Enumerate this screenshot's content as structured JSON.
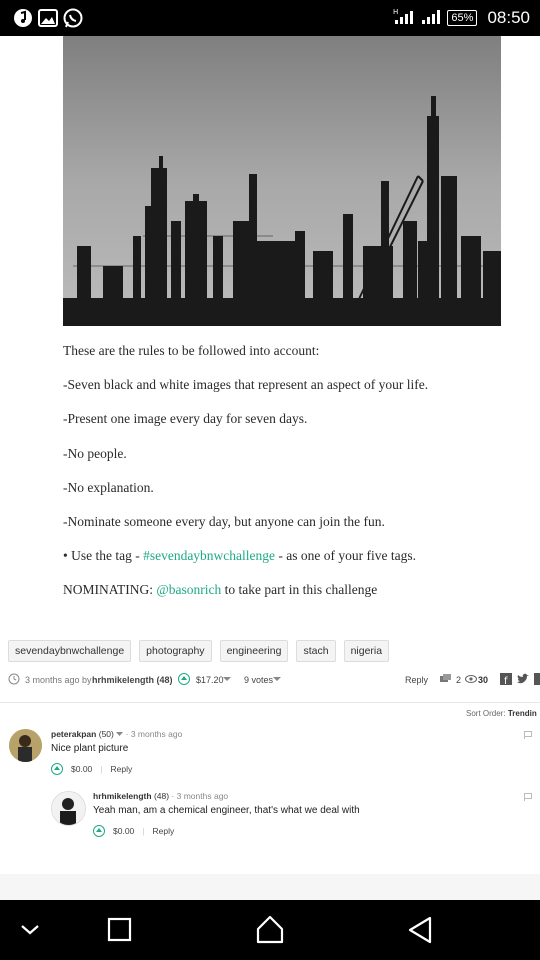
{
  "status_bar": {
    "battery": "65%",
    "time": "08:50",
    "left_icons": [
      "music-app-icon",
      "gallery-app-icon",
      "whatsapp-icon"
    ]
  },
  "post": {
    "image_alt": "",
    "paragraphs": [
      "These are the rules to be followed into account:",
      "-Seven black and white images that represent an aspect of your life.",
      "-Present one image every day for seven days.",
      "-No people.",
      "-No explanation.",
      "-Nominate someone every day, but anyone can join the fun."
    ],
    "tag_line": {
      "prefix": "• Use the tag - ",
      "link": "#sevendaybnwchallenge",
      "suffix": " - as one of your five tags."
    },
    "nominate_line": {
      "prefix": "NOMINATING: ",
      "link": "@basonrich",
      "suffix": " to take part in this challenge"
    },
    "tags": [
      "sevendaybnwchallenge",
      "photography",
      "engineering",
      "stach",
      "nigeria"
    ],
    "meta": {
      "time": "3 months ago by",
      "author": "hrhmikelength (48)",
      "payout": "$17.20",
      "votes": "9 votes",
      "reply": "Reply",
      "comments": "2",
      "views": "30"
    }
  },
  "comments": {
    "sort_label": "Sort Order:",
    "sort_value": "Trendin",
    "items": [
      {
        "author": "peterakpan",
        "rep": "(50)",
        "time": "3 months ago",
        "body": "Nice plant picture",
        "payout": "$0.00",
        "reply": "Reply"
      },
      {
        "author": "hrhmikelength",
        "rep": "(48)",
        "time": "3 months ago",
        "body": "Yeah man, am a chemical engineer, that's what we deal with",
        "payout": "$0.00",
        "reply": "Reply"
      }
    ]
  },
  "nav": [
    "back-chevron-icon",
    "recents-square-icon",
    "home-icon",
    "back-triangle-icon"
  ]
}
